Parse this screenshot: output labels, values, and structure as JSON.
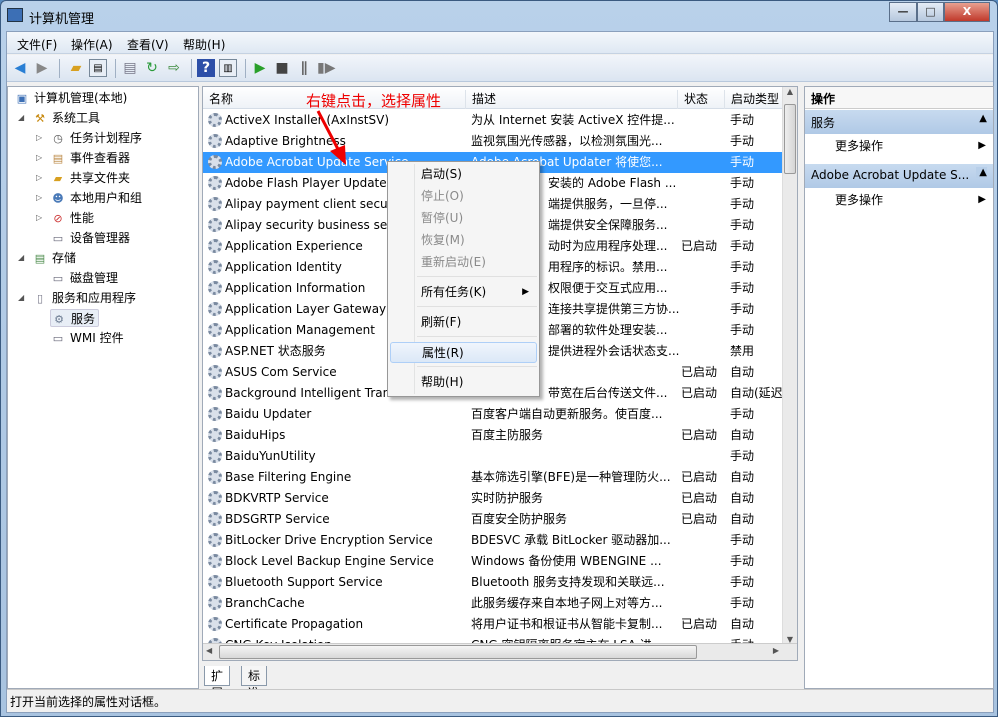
{
  "window": {
    "title": "计算机管理",
    "minimize": "—",
    "maximize": "□",
    "close": "X"
  },
  "menu": [
    "文件(F)",
    "操作(A)",
    "查看(V)",
    "帮助(H)"
  ],
  "tree": [
    {
      "label": "计算机管理(本地)",
      "icon": "computer-icon",
      "level": 0
    },
    {
      "label": "系统工具",
      "icon": "tools-icon",
      "level": 1,
      "expanded": true
    },
    {
      "label": "任务计划程序",
      "icon": "clock-icon",
      "level": 2,
      "collapsed": true
    },
    {
      "label": "事件查看器",
      "icon": "event-log-icon",
      "level": 2,
      "collapsed": true
    },
    {
      "label": "共享文件夹",
      "icon": "shared-folder-icon",
      "level": 2,
      "collapsed": true
    },
    {
      "label": "本地用户和组",
      "icon": "users-icon",
      "level": 2,
      "collapsed": true
    },
    {
      "label": "性能",
      "icon": "performance-icon",
      "level": 2,
      "collapsed": true
    },
    {
      "label": "设备管理器",
      "icon": "device-manager-icon",
      "level": 2
    },
    {
      "label": "存储",
      "icon": "storage-icon",
      "level": 1,
      "expanded": true
    },
    {
      "label": "磁盘管理",
      "icon": "disk-icon",
      "level": 2
    },
    {
      "label": "服务和应用程序",
      "icon": "services-apps-icon",
      "level": 1,
      "expanded": true
    },
    {
      "label": "服务",
      "icon": "gear-icon",
      "level": 2,
      "selected": true
    },
    {
      "label": "WMI 控件",
      "icon": "wmi-icon",
      "level": 2
    }
  ],
  "columns": {
    "name": "名称",
    "desc": "描述",
    "status": "状态",
    "type": "启动类型"
  },
  "services": [
    {
      "name": "ActiveX Installer (AxInstSV)",
      "desc": "为从 Internet 安装 ActiveX 控件提...",
      "status": "",
      "type": "手动"
    },
    {
      "name": "Adaptive Brightness",
      "desc": "监视氛围光传感器，以检测氛围光...",
      "status": "",
      "type": "手动"
    },
    {
      "name": "Adobe Acrobat Update Service",
      "desc": "Adobe Acrobat Updater 将使您...",
      "status": "",
      "type": "手动",
      "selected": true
    },
    {
      "name": "Adobe Flash Player Update Service",
      "desc": "安装的 Adobe Flash ...",
      "partial": true,
      "status": "",
      "type": "手动"
    },
    {
      "name": "Alipay payment client security service",
      "desc": "端提供服务，一旦停...",
      "partial": true,
      "status": "",
      "type": "手动"
    },
    {
      "name": "Alipay security business service",
      "desc": "端提供安全保障服务...",
      "partial": true,
      "status": "",
      "type": "手动"
    },
    {
      "name": "Application Experience",
      "desc": "动时为应用程序处理...",
      "partial": true,
      "status": "已启动",
      "type": "手动"
    },
    {
      "name": "Application Identity",
      "desc": "用程序的标识。禁用...",
      "partial": true,
      "status": "",
      "type": "手动"
    },
    {
      "name": "Application Information",
      "desc": "权限便于交互式应用...",
      "partial": true,
      "status": "",
      "type": "手动"
    },
    {
      "name": "Application Layer Gateway Service",
      "desc": "连接共享提供第三方协...",
      "partial": true,
      "status": "",
      "type": "手动"
    },
    {
      "name": "Application Management",
      "desc": "部署的软件处理安装...",
      "partial": true,
      "status": "",
      "type": "手动"
    },
    {
      "name": "ASP.NET 状态服务",
      "desc": "提供进程外会话状态支...",
      "partial": true,
      "status": "",
      "type": "禁用"
    },
    {
      "name": "ASUS Com Service",
      "desc": "",
      "status": "已启动",
      "type": "自动"
    },
    {
      "name": "Background Intelligent Transfer Service",
      "desc": "带宽在后台传送文件...",
      "partial": true,
      "status": "已启动",
      "type": "自动(延迟"
    },
    {
      "name": "Baidu Updater",
      "desc": "百度客户端自动更新服务。使百度...",
      "status": "",
      "type": "手动"
    },
    {
      "name": "BaiduHips",
      "desc": "百度主防服务",
      "status": "已启动",
      "type": "自动"
    },
    {
      "name": "BaiduYunUtility",
      "desc": "",
      "status": "",
      "type": "手动"
    },
    {
      "name": "Base Filtering Engine",
      "desc": "基本筛选引擎(BFE)是一种管理防火...",
      "status": "已启动",
      "type": "自动"
    },
    {
      "name": "BDKVRTP Service",
      "desc": "实时防护服务",
      "status": "已启动",
      "type": "自动"
    },
    {
      "name": "BDSGRTP Service",
      "desc": "百度安全防护服务",
      "status": "已启动",
      "type": "自动"
    },
    {
      "name": "BitLocker Drive Encryption Service",
      "desc": "BDESVC 承载 BitLocker 驱动器加...",
      "status": "",
      "type": "手动"
    },
    {
      "name": "Block Level Backup Engine Service",
      "desc": "Windows 备份使用 WBENGINE ...",
      "status": "",
      "type": "手动"
    },
    {
      "name": "Bluetooth Support Service",
      "desc": "Bluetooth 服务支持发现和关联远...",
      "status": "",
      "type": "手动"
    },
    {
      "name": "BranchCache",
      "desc": "此服务缓存来自本地子网上对等方...",
      "status": "",
      "type": "手动"
    },
    {
      "name": "Certificate Propagation",
      "desc": "将用户证书和根证书从智能卡复制...",
      "status": "已启动",
      "type": "自动"
    },
    {
      "name": "CNG Key Isolation",
      "desc": "CNG 密钥隔离服务宿主在 LSA 进",
      "status": "",
      "type": "手动"
    }
  ],
  "context_menu": [
    {
      "label": "启动(S)",
      "enabled": true
    },
    {
      "label": "停止(O)",
      "enabled": false
    },
    {
      "label": "暂停(U)",
      "enabled": false
    },
    {
      "label": "恢复(M)",
      "enabled": false
    },
    {
      "label": "重新启动(E)",
      "enabled": false
    },
    {
      "label": "所有任务(K)",
      "enabled": true,
      "submenu": true
    },
    {
      "label": "刷新(F)",
      "enabled": true
    },
    {
      "label": "属性(R)",
      "enabled": true,
      "highlighted": true
    },
    {
      "label": "帮助(H)",
      "enabled": true
    }
  ],
  "annotation": "右键点击，选择属性",
  "tabs": [
    "扩展",
    "标准"
  ],
  "actions": {
    "title": "操作",
    "sections": [
      {
        "title": "服务",
        "item": "更多操作"
      },
      {
        "title": "Adobe Acrobat Update S...",
        "item": "更多操作"
      }
    ]
  },
  "status_text": "打开当前选择的属性对话框。"
}
